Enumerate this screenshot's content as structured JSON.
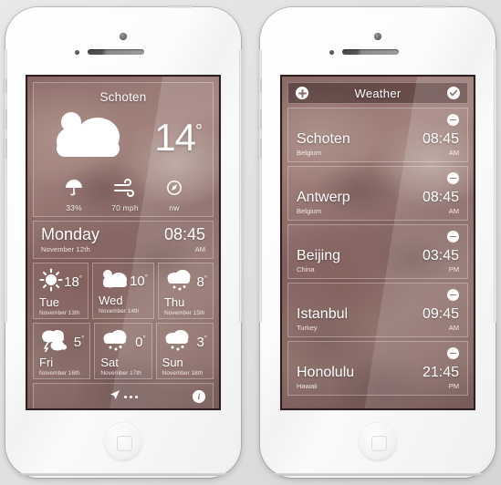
{
  "phone1": {
    "current": {
      "city": "Schoten",
      "temperature": "14",
      "degree": "°",
      "icon": "sun-behind-cloud-icon",
      "metrics": [
        {
          "icon": "umbrella-icon",
          "value": "33%",
          "name": "precipitation"
        },
        {
          "icon": "wind-icon",
          "value": "70 mph",
          "name": "wind-speed"
        },
        {
          "icon": "compass-icon",
          "value": "nw",
          "name": "wind-direction"
        }
      ]
    },
    "today": {
      "day": "Monday",
      "date": "November 12th",
      "time": "08:45",
      "meridiem": "AM"
    },
    "forecast": [
      {
        "day": "Tue",
        "date": "November 13th",
        "temp": "18",
        "degree": "°",
        "icon": "sun-icon"
      },
      {
        "day": "Wed",
        "date": "November 14th",
        "temp": "10",
        "degree": "°",
        "icon": "sun-behind-cloud-icon"
      },
      {
        "day": "Thu",
        "date": "November 15th",
        "temp": "8",
        "degree": "°",
        "icon": "snow-cloud-icon"
      },
      {
        "day": "Fri",
        "date": "November 16th",
        "temp": "5",
        "degree": "°",
        "icon": "thunderstorm-icon"
      },
      {
        "day": "Sat",
        "date": "November 17th",
        "temp": "0",
        "degree": "°",
        "icon": "snow-cloud-icon"
      },
      {
        "day": "Sun",
        "date": "November 18th",
        "temp": "3",
        "degree": "°",
        "icon": "snow-cloud-icon"
      }
    ],
    "bottombar": {
      "location_icon": "location-arrow-icon",
      "more_icon": "more-dots-icon",
      "info_label": "i"
    }
  },
  "phone2": {
    "header": {
      "add_icon": "plus-icon",
      "title": "Weather",
      "done_icon": "check-icon"
    },
    "cities": [
      {
        "name": "Schoten",
        "country": "Belgium",
        "time": "08:45",
        "meridiem": "AM",
        "remove_icon": "minus-icon"
      },
      {
        "name": "Antwerp",
        "country": "Belgium",
        "time": "08:45",
        "meridiem": "AM",
        "remove_icon": "minus-icon"
      },
      {
        "name": "Beijing",
        "country": "China",
        "time": "03:45",
        "meridiem": "PM",
        "remove_icon": "minus-icon"
      },
      {
        "name": "Istanbul",
        "country": "Turkey",
        "time": "09:45",
        "meridiem": "AM",
        "remove_icon": "minus-icon"
      },
      {
        "name": "Honolulu",
        "country": "Hawaii",
        "time": "21:45",
        "meridiem": "PM",
        "remove_icon": "minus-icon"
      }
    ]
  },
  "colors": {
    "background": "#e4e4e4",
    "device": "#fbfbfb",
    "screen_tint": "#8b6a66",
    "text": "#ffffff"
  }
}
